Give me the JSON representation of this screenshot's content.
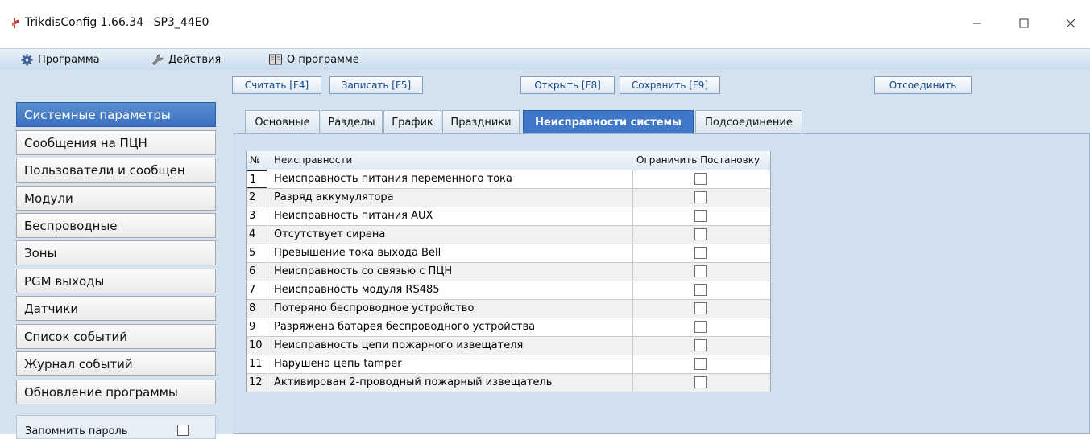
{
  "window": {
    "title": "TrikdisConfig 1.66.34",
    "device": "SP3_44E0",
    "controls": [
      "minimize-icon",
      "maximize-icon",
      "close-icon"
    ]
  },
  "menu": {
    "program": "Программа",
    "actions": "Действия",
    "about": "О программе"
  },
  "toolbar": {
    "read": "Считать [F4]",
    "write": "Записать [F5]",
    "open": "Открыть [F8]",
    "save": "Сохранить [F9]",
    "disconnect": "Отсоединить"
  },
  "sidebar": {
    "active_index": 0,
    "items": [
      {
        "label": "Системные параметры"
      },
      {
        "label": "Сообщения на ПЦН"
      },
      {
        "label": "Пользователи и сообщен"
      },
      {
        "label": "Модули"
      },
      {
        "label": "Беспроводные"
      },
      {
        "label": "Зоны"
      },
      {
        "label": "PGM выходы"
      },
      {
        "label": "Датчики"
      },
      {
        "label": "Список событий"
      },
      {
        "label": "Журнал событий"
      },
      {
        "label": "Обновление программы"
      }
    ],
    "remember_password": {
      "label": "Запомнить пароль",
      "checked": false
    }
  },
  "tabs": {
    "active_index": 4,
    "items": [
      {
        "label": "Основные"
      },
      {
        "label": "Разделы"
      },
      {
        "label": "График"
      },
      {
        "label": "Праздники"
      },
      {
        "label": "Неисправности системы"
      },
      {
        "label": "Подсоединение"
      }
    ]
  },
  "table": {
    "headers": {
      "no": "№",
      "fault": "Неисправности",
      "restrict": "Ограничить Постановку"
    },
    "rows": [
      {
        "no": "1",
        "name": "Неисправность питания переменного тока",
        "checked": false
      },
      {
        "no": "2",
        "name": "Разряд аккумулятора",
        "checked": false
      },
      {
        "no": "3",
        "name": "Неисправность питания AUX",
        "checked": false
      },
      {
        "no": "4",
        "name": "Отсутствует сирена",
        "checked": false
      },
      {
        "no": "5",
        "name": "Превышение тока выхода Bell",
        "checked": false
      },
      {
        "no": "6",
        "name": "Неисправность со связью с ПЦН",
        "checked": false
      },
      {
        "no": "7",
        "name": "Неисправность модуля RS485",
        "checked": false
      },
      {
        "no": "8",
        "name": "Потеряно беспроводное устройство",
        "checked": false
      },
      {
        "no": "9",
        "name": "Разряжена батарея беспроводного устройства",
        "checked": false
      },
      {
        "no": "10",
        "name": "Неисправность цепи пожарного извещателя",
        "checked": false
      },
      {
        "no": "11",
        "name": "Нарушена цепь tamper",
        "checked": false
      },
      {
        "no": "12",
        "name": "Активирован 2-проводный пожарный извещатель",
        "checked": false
      }
    ]
  },
  "colors": {
    "accent": "#3f78c8",
    "menubar": "#c9dbee",
    "workarea": "#d4e1ef",
    "app_icon": "#c0392b"
  }
}
